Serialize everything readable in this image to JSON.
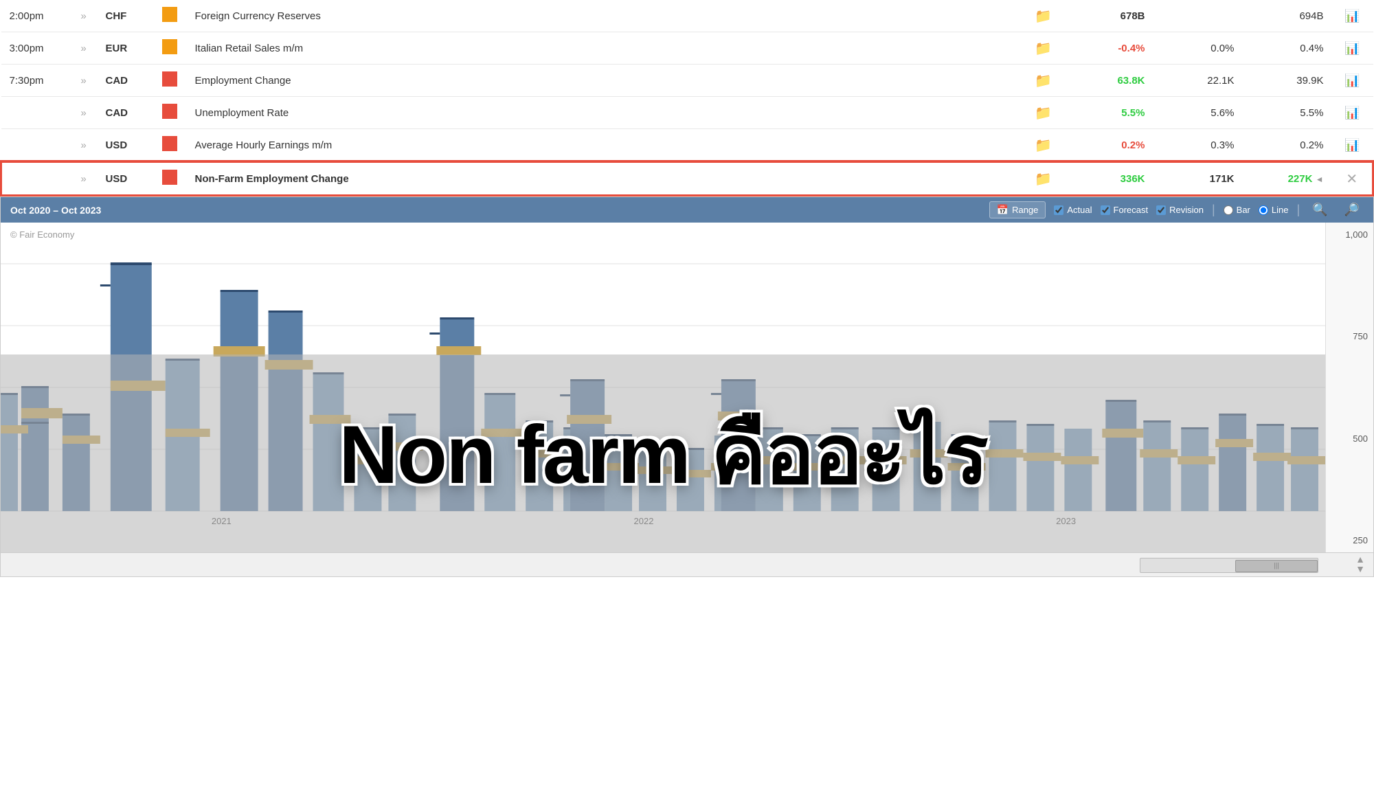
{
  "table": {
    "rows": [
      {
        "time": "2:00pm",
        "has_sound": true,
        "currency": "CHF",
        "impact": "medium",
        "impact_color": "#f39c12",
        "event": "Foreign Currency Reserves",
        "actual": "678B",
        "actual_color": "#333",
        "forecast": "",
        "previous": "694B",
        "previous_color": "#333"
      },
      {
        "time": "3:00pm",
        "has_sound": true,
        "currency": "EUR",
        "impact": "medium",
        "impact_color": "#f39c12",
        "event": "Italian Retail Sales m/m",
        "actual": "-0.4%",
        "actual_color": "#e74c3c",
        "forecast": "0.0%",
        "previous": "0.4%",
        "previous_color": "#333"
      },
      {
        "time": "7:30pm",
        "has_sound": true,
        "currency": "CAD",
        "impact": "high",
        "impact_color": "#e74c3c",
        "event": "Employment Change",
        "actual": "63.8K",
        "actual_color": "#2ecc40",
        "forecast": "22.1K",
        "previous": "39.9K",
        "previous_color": "#333"
      },
      {
        "time": "",
        "has_sound": true,
        "currency": "CAD",
        "impact": "high",
        "impact_color": "#e74c3c",
        "event": "Unemployment Rate",
        "actual": "5.5%",
        "actual_color": "#2ecc40",
        "forecast": "5.6%",
        "previous": "5.5%",
        "previous_color": "#333"
      },
      {
        "time": "",
        "has_sound": true,
        "currency": "USD",
        "impact": "high",
        "impact_color": "#e74c3c",
        "event": "Average Hourly Earnings m/m",
        "actual": "0.2%",
        "actual_color": "#e74c3c",
        "forecast": "0.3%",
        "previous": "0.2%",
        "previous_color": "#333"
      },
      {
        "time": "",
        "has_sound": true,
        "currency": "USD",
        "impact": "high",
        "impact_color": "#e74c3c",
        "event": "Non-Farm Employment Change",
        "actual": "336K",
        "actual_color": "#2ecc40",
        "forecast": "171K",
        "previous": "227K",
        "previous_color": "#2ecc40",
        "highlighted": true,
        "revision_arrow": true
      }
    ]
  },
  "chart": {
    "date_range": "Oct 2020 – Oct 2023",
    "watermark": "© Fair Economy",
    "range_btn": "Range",
    "actual_label": "Actual",
    "forecast_label": "Forecast",
    "revision_label": "Revision",
    "bar_label": "Bar",
    "line_label": "Line",
    "y_axis": [
      "1,000",
      "750",
      "500",
      "250"
    ],
    "x_labels": [
      "2021",
      "2022",
      "2023"
    ]
  },
  "overlay": {
    "text": "Non farm คืออะไร"
  }
}
